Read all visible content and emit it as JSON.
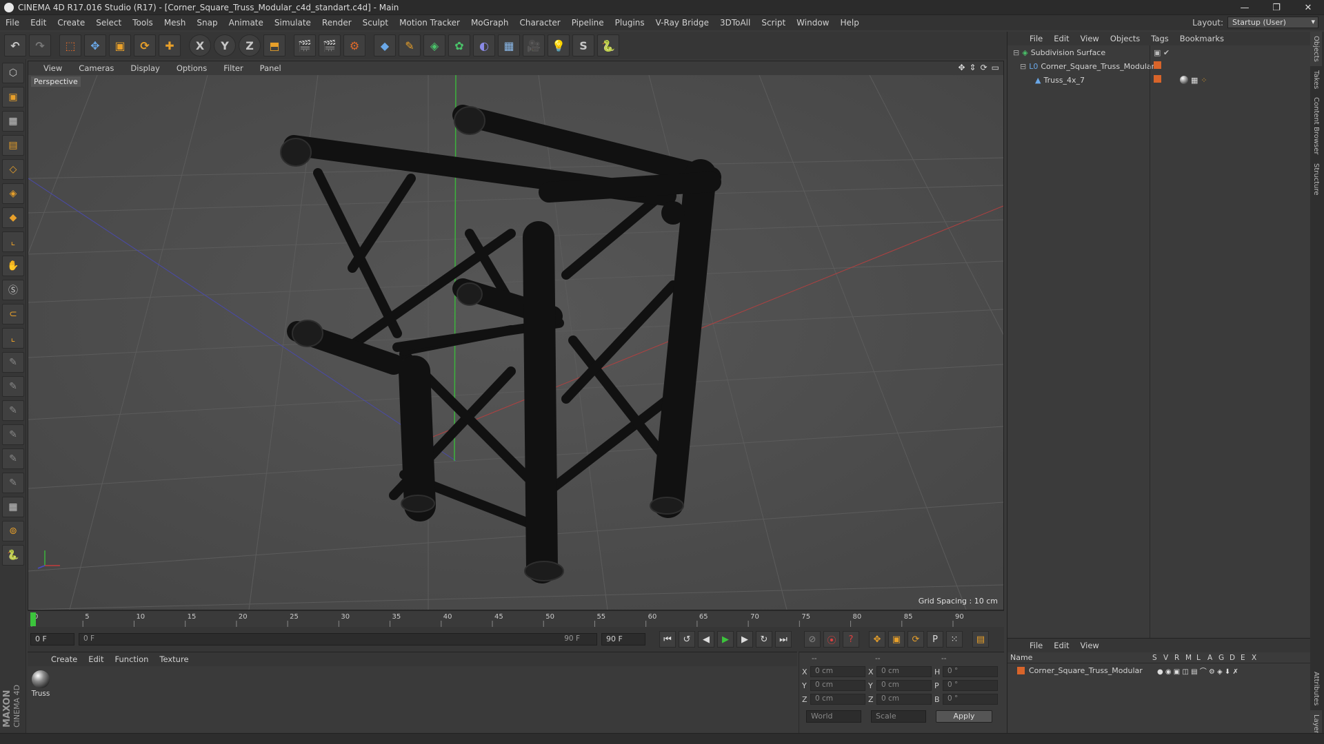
{
  "window": {
    "title": "CINEMA 4D R17.016 Studio (R17) - [Corner_Square_Truss_Modular_c4d_standart.c4d] - Main",
    "controls": [
      "—",
      "❐",
      "✕"
    ]
  },
  "menubar": {
    "items": [
      "File",
      "Edit",
      "Create",
      "Select",
      "Tools",
      "Mesh",
      "Snap",
      "Animate",
      "Simulate",
      "Render",
      "Sculpt",
      "Motion Tracker",
      "MoGraph",
      "Character",
      "Pipeline",
      "Plugins",
      "V-Ray Bridge",
      "3DToAll",
      "Script",
      "Window",
      "Help"
    ],
    "layout_label": "Layout:",
    "layout_value": "Startup (User)"
  },
  "toolbar": {
    "axis_x": "X",
    "axis_y": "Y",
    "axis_z": "Z"
  },
  "viewport": {
    "menu": [
      "View",
      "Cameras",
      "Display",
      "Options",
      "Filter",
      "Panel"
    ],
    "camera_label": "Perspective",
    "grid_spacing": "Grid Spacing : 10 cm"
  },
  "timeline": {
    "ticks": [
      "0",
      "5",
      "10",
      "15",
      "20",
      "25",
      "30",
      "35",
      "40",
      "45",
      "50",
      "55",
      "60",
      "65",
      "70",
      "75",
      "80",
      "85",
      "90"
    ],
    "current_frame": "0 F"
  },
  "transport": {
    "start_field": "0 F",
    "range_start": "0 F",
    "range_end": "90 F",
    "end_field": "90 F"
  },
  "material_panel": {
    "menu": [
      "Create",
      "Edit",
      "Function",
      "Texture"
    ],
    "material_name": "Truss"
  },
  "coordinates": {
    "header": [
      "--",
      "--",
      "--"
    ],
    "rows": [
      {
        "label": "X",
        "pos": "0 cm",
        "label2": "X",
        "size": "0 cm",
        "label3": "H",
        "rot": "0 °"
      },
      {
        "label": "Y",
        "pos": "0 cm",
        "label2": "Y",
        "size": "0 cm",
        "label3": "P",
        "rot": "0 °"
      },
      {
        "label": "Z",
        "pos": "0 cm",
        "label2": "Z",
        "size": "0 cm",
        "label3": "B",
        "rot": "0 °"
      }
    ],
    "world": "World",
    "scale": "Scale",
    "apply": "Apply"
  },
  "object_manager": {
    "menu": [
      "File",
      "Edit",
      "View",
      "Objects",
      "Tags",
      "Bookmarks"
    ],
    "objects": [
      {
        "name": "Subdivision Surface"
      },
      {
        "name": "Corner_Square_Truss_Modular"
      },
      {
        "name": "Truss_4x_7"
      }
    ]
  },
  "layer_manager": {
    "menu": [
      "File",
      "Edit",
      "View"
    ],
    "name_header": "Name",
    "col_headers": [
      "S",
      "V",
      "R",
      "M",
      "L",
      "A",
      "G",
      "D",
      "E",
      "X"
    ],
    "layer_name": "Corner_Square_Truss_Modular"
  },
  "side_tabs": [
    "Objects",
    "Takes",
    "Content Browser",
    "Structure"
  ],
  "side_tabs_bottom": [
    "Attributes",
    "Layers"
  ],
  "branding": {
    "maxon": "MAXON",
    "c4d": "CINEMA 4D"
  },
  "colors": {
    "accent_orange": "#d8642a",
    "bg": "#3a3a3a",
    "viewport_bg": "#4b4b4b",
    "green_axis": "#3cc43c",
    "red_axis": "#c43c3c",
    "blue_axis": "#3c3cc4"
  }
}
